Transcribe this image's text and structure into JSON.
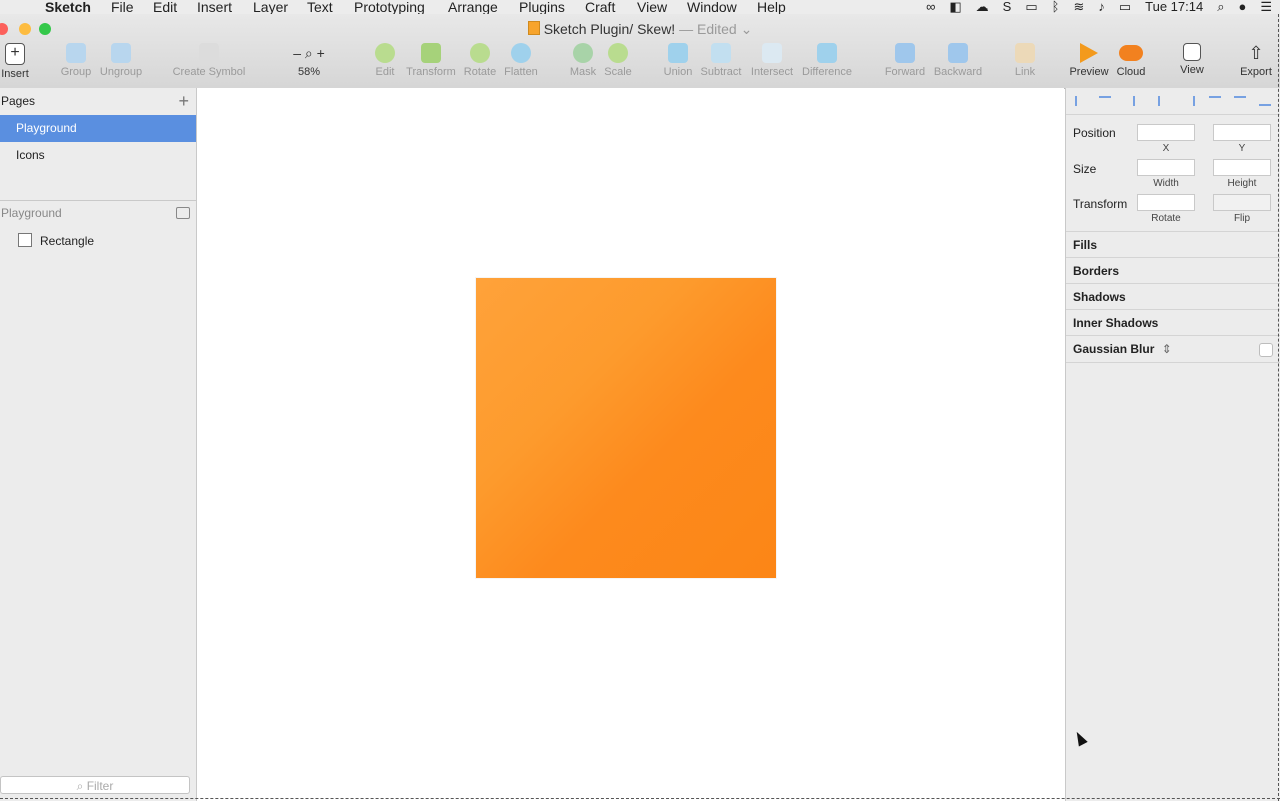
{
  "menubar": {
    "app_name": "Sketch",
    "menus": [
      "File",
      "Edit",
      "Insert",
      "Layer",
      "Text",
      "Prototyping",
      "Arrange",
      "Plugins",
      "Craft",
      "View",
      "Window",
      "Help"
    ],
    "clock": "Tue 17:14"
  },
  "window": {
    "title": "Sketch Plugin/ Skew!",
    "edited": "— Edited"
  },
  "toolbar": {
    "insert": "Insert",
    "group": "Group",
    "ungroup": "Ungroup",
    "create_symbol": "Create Symbol",
    "zoom": "58%",
    "edit": "Edit",
    "transform": "Transform",
    "rotate": "Rotate",
    "flatten": "Flatten",
    "mask": "Mask",
    "scale": "Scale",
    "union": "Union",
    "subtract": "Subtract",
    "intersect": "Intersect",
    "difference": "Difference",
    "forward": "Forward",
    "backward": "Backward",
    "link": "Link",
    "preview": "Preview",
    "cloud": "Cloud",
    "view": "View",
    "export": "Export"
  },
  "sidebar": {
    "pages_header": "Pages",
    "pages": [
      {
        "label": "Playground",
        "selected": true
      },
      {
        "label": "Icons",
        "selected": false
      }
    ],
    "layers_header": "Playground",
    "layers": [
      {
        "label": "Rectangle"
      }
    ],
    "filter_placeholder": "Filter"
  },
  "inspector": {
    "position_label": "Position",
    "size_label": "Size",
    "transform_label": "Transform",
    "x_label": "X",
    "y_label": "Y",
    "width_label": "Width",
    "height_label": "Height",
    "rotate_label": "Rotate",
    "flip_label": "Flip",
    "sections": [
      "Fills",
      "Borders",
      "Shadows",
      "Inner Shadows",
      "Gaussian Blur"
    ]
  },
  "colors": {
    "accent": "#5a8fe0",
    "shape_fill": "#fd9628"
  }
}
